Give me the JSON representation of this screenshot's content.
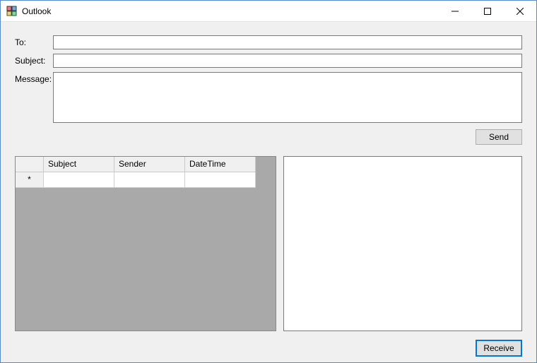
{
  "window": {
    "title": "Outlook"
  },
  "form": {
    "to_label": "To:",
    "to_value": "",
    "subject_label": "Subject:",
    "subject_value": "",
    "message_label": "Message:",
    "message_value": ""
  },
  "buttons": {
    "send": "Send",
    "receive": "Receive"
  },
  "grid": {
    "columns": [
      "Subject",
      "Sender",
      "DateTime"
    ],
    "new_row_marker": "*",
    "rows": []
  }
}
